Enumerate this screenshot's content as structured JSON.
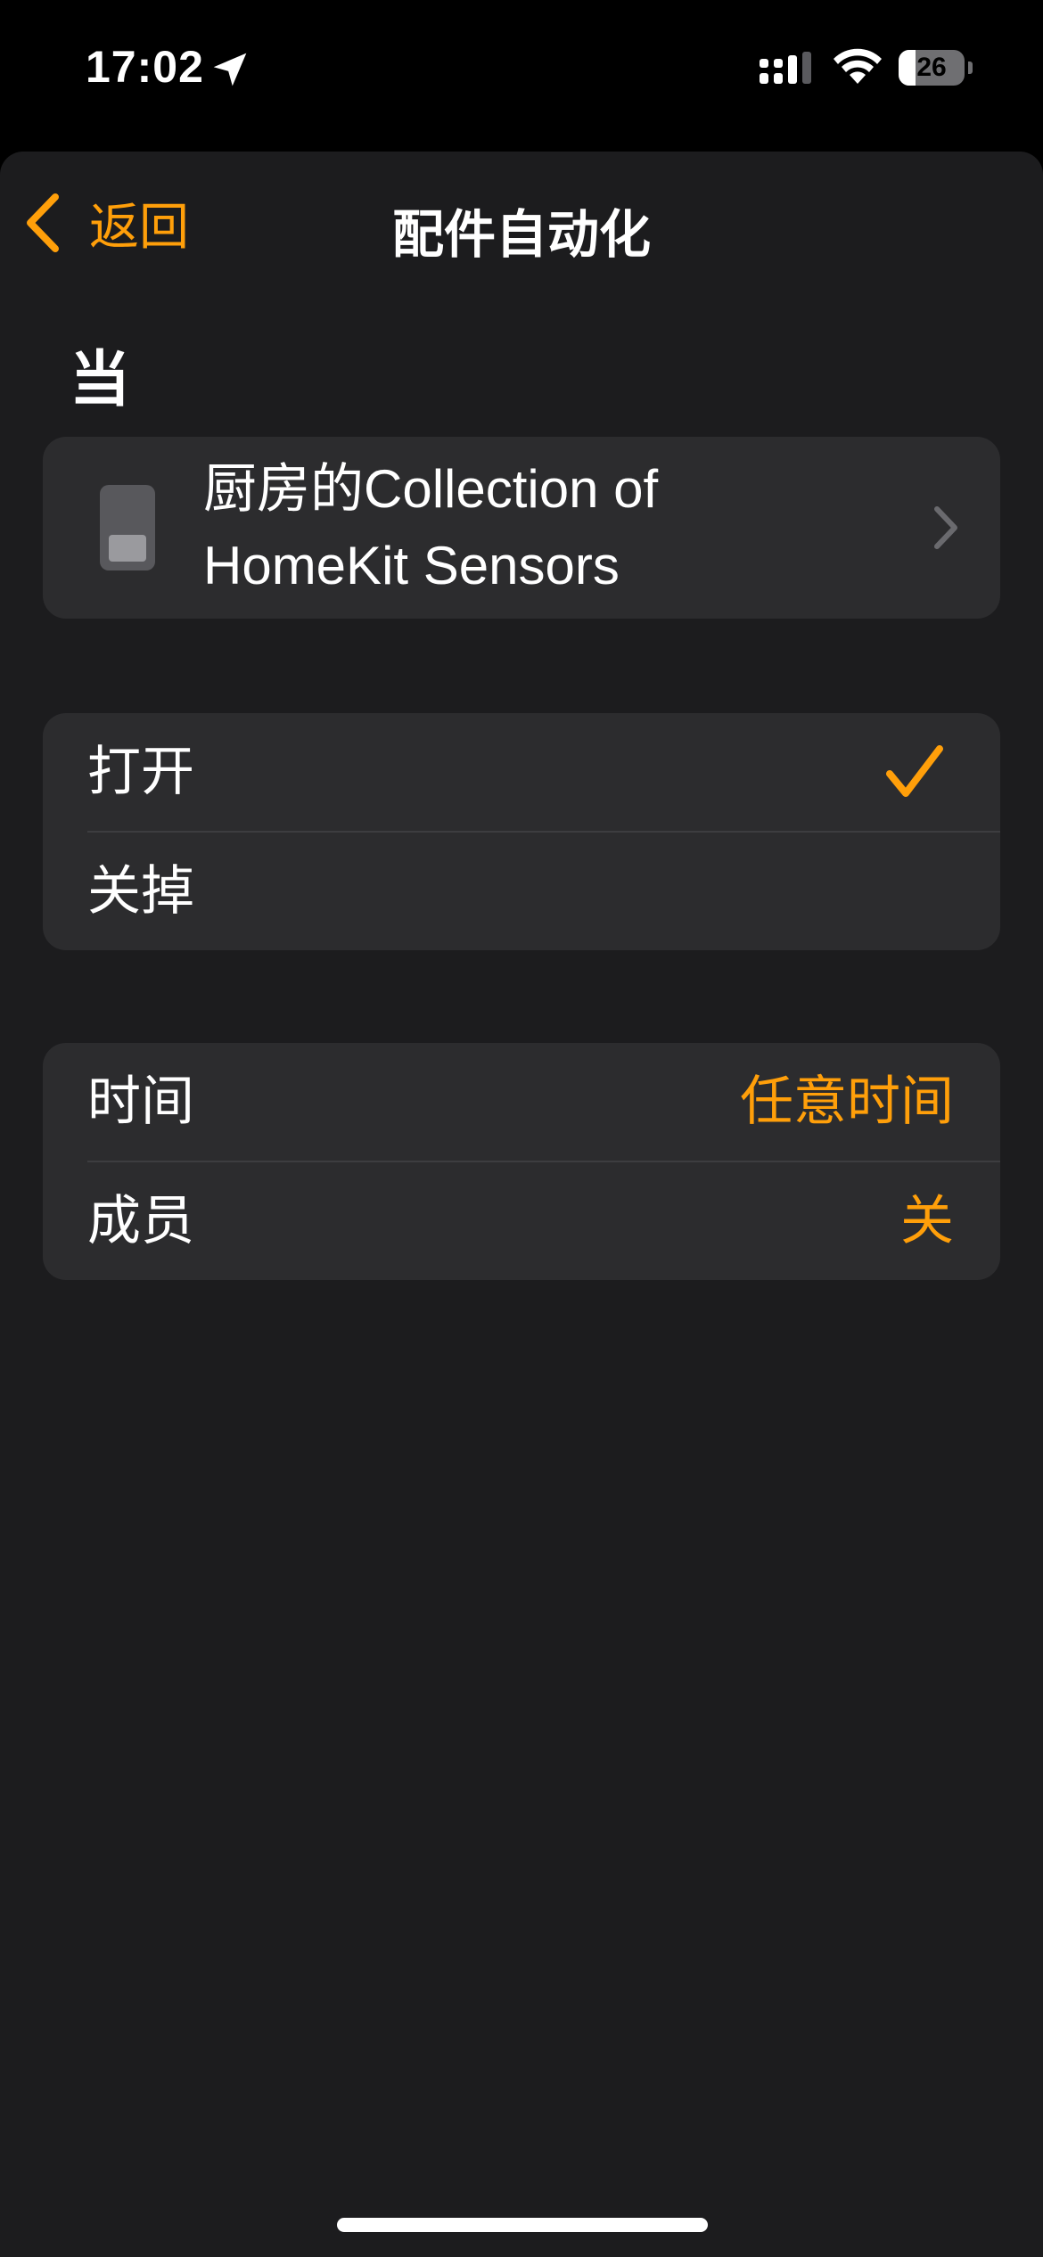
{
  "status_bar": {
    "time": "17:02",
    "battery": "26",
    "battery_level": 0.26
  },
  "nav": {
    "back_label": "返回",
    "title": "配件自动化"
  },
  "section_header": "当",
  "accessory": {
    "name": "厨房的Collection of HomeKit Sensors",
    "icon": "switch-icon"
  },
  "state_options": [
    {
      "label": "打开",
      "selected": true
    },
    {
      "label": "关掉",
      "selected": false
    }
  ],
  "conditions": [
    {
      "label": "时间",
      "value": "任意时间"
    },
    {
      "label": "成员",
      "value": "关"
    }
  ],
  "colors": {
    "accent": "#ff9f0a",
    "background": "#1c1c1e",
    "card": "#2c2c2e"
  }
}
